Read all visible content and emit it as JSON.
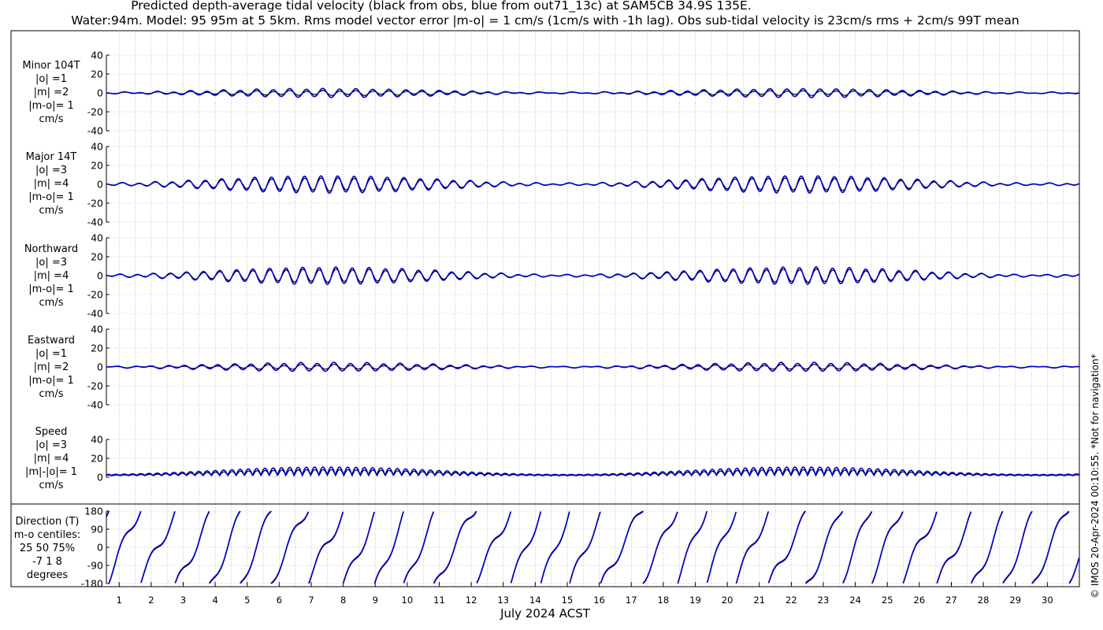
{
  "title": {
    "line1": "Predicted depth-average tidal velocity (black from obs, blue from out71_13c) at SAM5CB 34.9S 135E.",
    "line2": "Water:94m. Model: 95 95m at 5 5km. Rms model vector error |m-o| = 1 cm/s (1cm/s with -1h lag). Obs sub-tidal velocity is 23cm/s rms + 2cm/s 99T mean"
  },
  "side_note": "© IMOS 20-Apr-2024 00:10:55. *Not for navigation*",
  "colors": {
    "obs": "#000000",
    "model": "#0000c8",
    "grid": "#9a9a9a"
  },
  "chart_data": [
    {
      "type": "line",
      "panel": "minor",
      "label_lines": [
        "Minor 104T",
        "|o| =1",
        "|m| =2",
        "|m-o|= 1",
        "cm/s"
      ],
      "ylim": [
        -40,
        40
      ],
      "yticks": [
        "40",
        "20",
        "0",
        "-20",
        "-40"
      ],
      "series": [
        {
          "name": "obs",
          "amplitude": 1,
          "mean": 0
        },
        {
          "name": "model",
          "amplitude": 2,
          "mean": 0
        }
      ]
    },
    {
      "type": "line",
      "panel": "major",
      "label_lines": [
        "Major 14T",
        "|o| =3",
        "|m| =4",
        "|m-o|= 1",
        "cm/s"
      ],
      "ylim": [
        -40,
        40
      ],
      "yticks": [
        "40",
        "20",
        "0",
        "-20",
        "-40"
      ],
      "series": [
        {
          "name": "obs",
          "amplitude": 3,
          "mean": 0
        },
        {
          "name": "model",
          "amplitude": 4,
          "mean": 0
        }
      ]
    },
    {
      "type": "line",
      "panel": "northward",
      "label_lines": [
        "Northward",
        "|o| =3",
        "|m| =4",
        "|m-o|= 1",
        "cm/s"
      ],
      "ylim": [
        -40,
        40
      ],
      "yticks": [
        "40",
        "20",
        "0",
        "-20",
        "-40"
      ],
      "series": [
        {
          "name": "obs",
          "amplitude": 3,
          "mean": 0
        },
        {
          "name": "model",
          "amplitude": 4,
          "mean": 0
        }
      ]
    },
    {
      "type": "line",
      "panel": "eastward",
      "label_lines": [
        "Eastward",
        "|o| =1",
        "|m| =2",
        "|m-o|= 1",
        "cm/s"
      ],
      "ylim": [
        -40,
        40
      ],
      "yticks": [
        "40",
        "20",
        "0",
        "-20",
        "-40"
      ],
      "series": [
        {
          "name": "obs",
          "amplitude": 1,
          "mean": 0
        },
        {
          "name": "model",
          "amplitude": 2,
          "mean": 0
        }
      ]
    },
    {
      "type": "line",
      "panel": "speed",
      "label_lines": [
        "Speed",
        "|o| =3",
        "|m| =4",
        "|m|-|o|= 1",
        "cm/s"
      ],
      "ylim": [
        0,
        40
      ],
      "yticks": [
        "40",
        "20",
        "0"
      ],
      "series": [
        {
          "name": "obs",
          "amplitude": 3,
          "mean": 3
        },
        {
          "name": "model",
          "amplitude": 4,
          "mean": 4
        }
      ]
    },
    {
      "type": "line",
      "panel": "direction",
      "label_lines": [
        "Direction (T)",
        "m-o centiles:",
        "25  50  75%",
        "-7  1  8",
        "degrees"
      ],
      "ylim": [
        -180,
        180
      ],
      "yticks": [
        "180",
        "90",
        "0",
        "-90",
        "-180"
      ],
      "series": [
        {
          "name": "obs",
          "range": [
            -180,
            180
          ]
        },
        {
          "name": "model",
          "range": [
            -180,
            180
          ]
        }
      ]
    }
  ],
  "x_axis": {
    "label": "July 2024 ACST",
    "days": [
      "1",
      "2",
      "3",
      "4",
      "5",
      "6",
      "7",
      "8",
      "9",
      "10",
      "11",
      "12",
      "13",
      "14",
      "15",
      "16",
      "17",
      "18",
      "19",
      "20",
      "21",
      "22",
      "23",
      "24",
      "25",
      "26",
      "27",
      "28",
      "29",
      "30"
    ],
    "start_day": 0.6,
    "end_day": 31.0
  }
}
